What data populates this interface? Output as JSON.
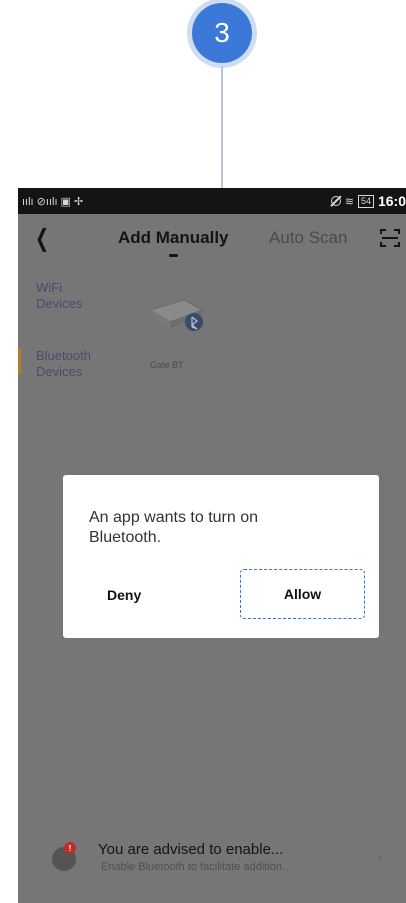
{
  "step": {
    "number": "3"
  },
  "status_bar": {
    "left": "ıılı ⊘ıılı ▣ ✢",
    "wifi": "≋",
    "battery": "54",
    "time": "16:0"
  },
  "header": {
    "back_icon": "chevron-left-icon",
    "title": "Add Manually",
    "tab_auto_scan": "Auto Scan",
    "scan_icon": "scan-frame-icon"
  },
  "sidebar": {
    "items": [
      {
        "label": "WiFi Devices",
        "active": false
      },
      {
        "label": "Bluetooth Devices",
        "active": true
      }
    ]
  },
  "device": {
    "label": "Gate BT",
    "icon": "bluetooth-icon"
  },
  "dialog": {
    "message": "An app wants to turn on Bluetooth.",
    "deny": "Deny",
    "allow": "Allow"
  },
  "banner": {
    "title": "You are advised to enable...",
    "subtitle": "Enable Bluetooth to facilitate addition...",
    "badge": "!",
    "arrow": "›"
  },
  "colors": {
    "step_badge": "#3b78d8",
    "overlay": "#767676",
    "allow_border": "#3d6fdc",
    "alert_dot": "#c02b2b"
  }
}
